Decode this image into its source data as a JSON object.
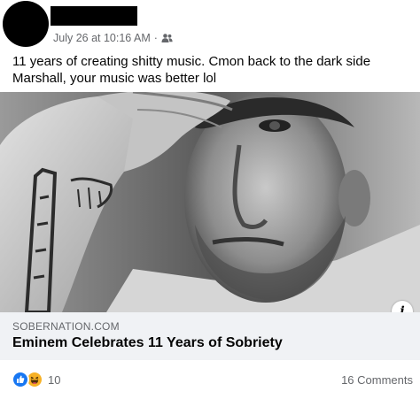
{
  "post": {
    "timestamp": "July 26 at 10:16 AM",
    "separator": "·",
    "audience_icon": "friends-icon",
    "text": "11 years of creating shitty music. Cmon back to the dark side Marshall, your music was better lol"
  },
  "link": {
    "domain": "SOBERNATION.COM",
    "title": "Eminem Celebrates 11 Years of Sobriety",
    "info_icon": "i"
  },
  "footer": {
    "reaction_icons": [
      "like-icon",
      "haha-icon"
    ],
    "reaction_count": "10",
    "comments": "16 Comments"
  },
  "colors": {
    "secondary_text": "#65676b",
    "link_caption_bg": "#f0f2f5",
    "like_blue": "#1877f2",
    "haha_yellow": "#f7b125"
  }
}
